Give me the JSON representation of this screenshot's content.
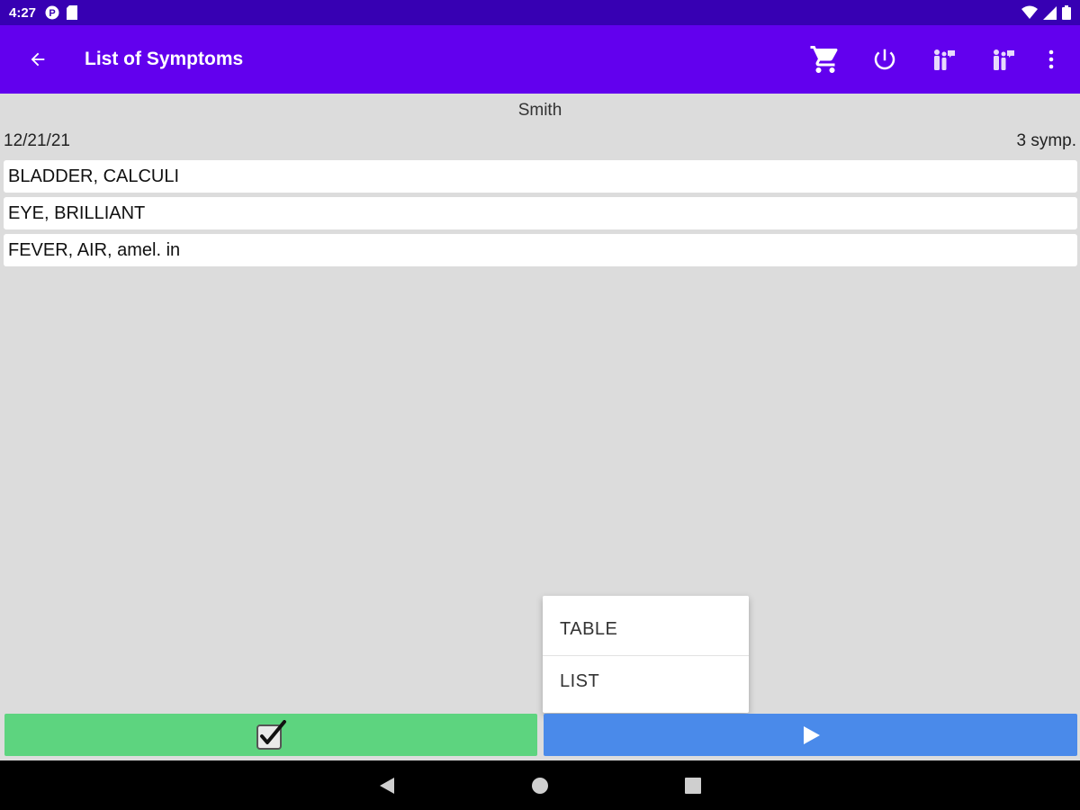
{
  "status_bar": {
    "time": "4:27",
    "icons": [
      "circle-p-icon",
      "sd-card-icon",
      "wifi-icon",
      "signal-icon",
      "battery-icon"
    ]
  },
  "app_bar": {
    "title": "List of Symptoms",
    "back_icon": "arrow-left-icon",
    "actions": [
      "cart-icon",
      "power-icon",
      "family-icon",
      "family-icon",
      "more-vertical-icon"
    ]
  },
  "header": {
    "patient_name": "Smith",
    "date": "12/21/21",
    "count": "3 symp."
  },
  "symptoms": [
    "BLADDER, CALCULI",
    "EYE, BRILLIANT",
    "FEVER, AIR, amel. in"
  ],
  "popup_menu": {
    "items": [
      "TABLE",
      "LIST"
    ]
  },
  "bottom_bar": {
    "confirm_icon": "checkbox-checked-icon",
    "play_icon": "play-icon",
    "confirm_color": "#5dd47f",
    "play_color": "#4a8aea"
  },
  "colors": {
    "status_bar": "#3700b3",
    "app_bar": "#6200ee",
    "background": "#dcdcdc"
  }
}
